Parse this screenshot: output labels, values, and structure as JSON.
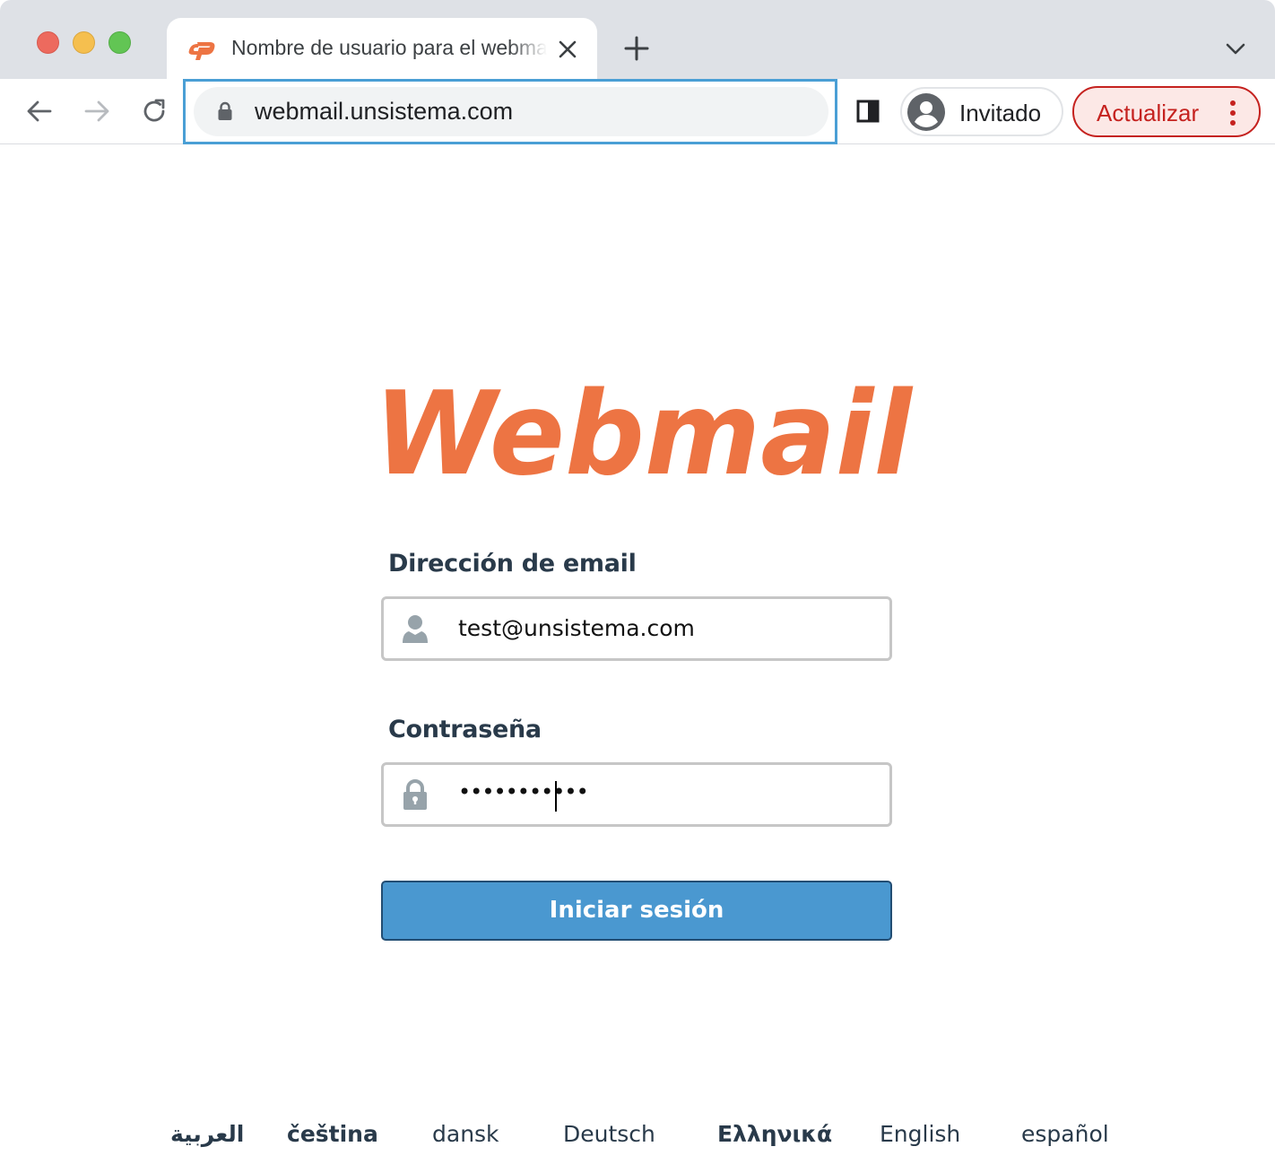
{
  "browser": {
    "tab_title": "Nombre de usuario para el webmail",
    "url": "webmail.unsistema.com",
    "profile_label": "Invitado",
    "update_label": "Actualizar"
  },
  "page": {
    "logo_text": "Webmail",
    "email_label": "Dirección de email",
    "email_value": "test@unsistema.com",
    "password_label": "Contraseña",
    "password_mask": "•••••••••••",
    "login_button": "Iniciar sesión"
  },
  "languages": [
    "العربية",
    "čeština",
    "dansk",
    "Deutsch",
    "Ελληνικά",
    "English",
    "español"
  ],
  "colors": {
    "brand_orange": "#ed7443",
    "login_button": "#4a98d0",
    "label_text": "#293a4a",
    "omnibox_focus": "#4a9fd5",
    "update_red": "#c5221f"
  }
}
